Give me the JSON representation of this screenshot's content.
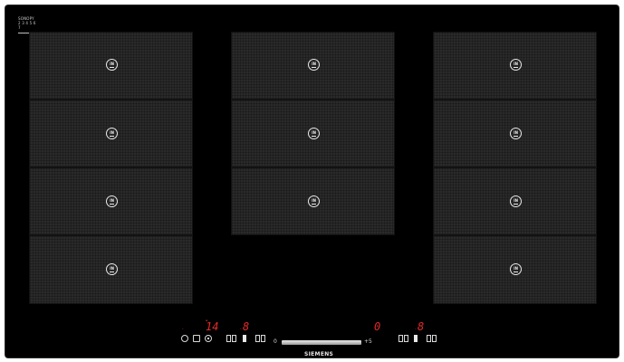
{
  "brand": {
    "mark_line1": "SONOPY",
    "mark_line2": "2 3 4 5 6 7",
    "logo": "SIEMENS"
  },
  "zones": [
    {
      "column": "left",
      "rows": 4
    },
    {
      "column": "center",
      "rows": 3
    },
    {
      "column": "right",
      "rows": 4
    }
  ],
  "zone_icon_text": "IN",
  "controls": {
    "left_power": "14",
    "right_power": "0",
    "left_timer": "8",
    "right_timer": "8",
    "slider_start": "0",
    "slider_end": "+5"
  },
  "colors": {
    "accent_red": "#e52a2a",
    "surface": "#2a2a2a",
    "background": "#000000"
  }
}
